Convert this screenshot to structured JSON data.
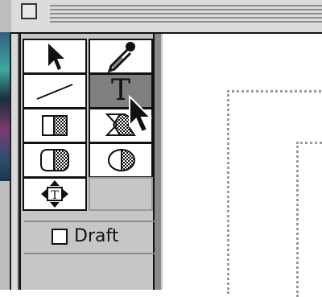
{
  "palette": {
    "tools": [
      {
        "name": "arrow",
        "icon": "arrow-icon"
      },
      {
        "name": "eyedropper",
        "icon": "eyedropper-icon"
      },
      {
        "name": "line",
        "icon": "line-icon"
      },
      {
        "name": "text",
        "icon": "text-icon",
        "glyph": "T",
        "active": true
      },
      {
        "name": "rectangle",
        "icon": "rectangle-icon"
      },
      {
        "name": "polygon",
        "icon": "polygon-icon"
      },
      {
        "name": "rounded-rectangle",
        "icon": "rounded-rectangle-icon"
      },
      {
        "name": "oval",
        "icon": "oval-icon"
      },
      {
        "name": "move",
        "icon": "move-icon"
      }
    ],
    "draft": {
      "label": "Draft",
      "checked": false
    }
  },
  "colors": {
    "palette_bg": "#c6c6c6",
    "active_tool": "#7f7f7f",
    "guide": "#9a9a9a"
  }
}
